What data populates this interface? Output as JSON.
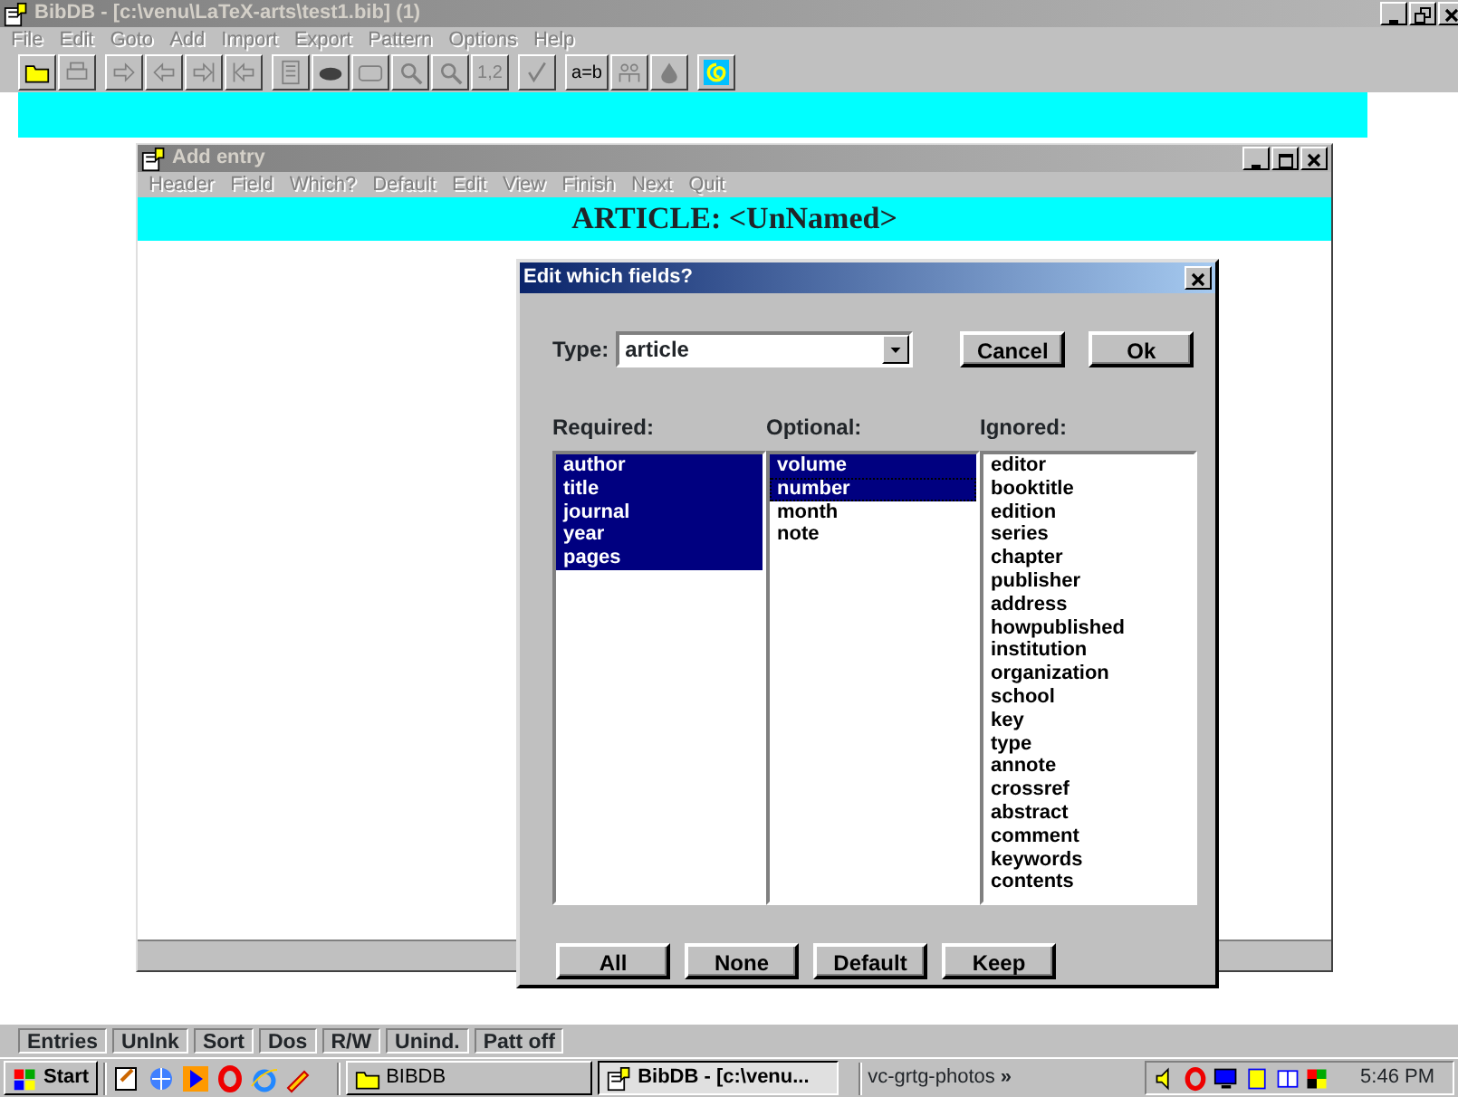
{
  "app": {
    "title": "BibDB - [c:\\venu\\LaTeX-arts\\test1.bib] (1)",
    "menu": [
      "File",
      "Edit",
      "Goto",
      "Add",
      "Import",
      "Export",
      "Pattern",
      "Options",
      "Help"
    ],
    "toolbar_labels": [
      "1,2",
      "a=b"
    ]
  },
  "child": {
    "title": "Add entry",
    "menu": [
      "Header",
      "Field",
      "Which?",
      "Default",
      "Edit",
      "View",
      "Finish",
      "Next",
      "Quit"
    ],
    "header": "ARTICLE: <UnNamed>"
  },
  "dialog": {
    "title": "Edit which fields?",
    "type_label": "Type:",
    "type_value": "article",
    "top_buttons": [
      "Cancel",
      "Ok"
    ],
    "lists": [
      {
        "heading": "Required:",
        "items": [
          {
            "text": "author",
            "selected": true,
            "focused": false
          },
          {
            "text": "title",
            "selected": true,
            "focused": false
          },
          {
            "text": "journal",
            "selected": true,
            "focused": false
          },
          {
            "text": "year",
            "selected": true,
            "focused": false
          },
          {
            "text": "pages",
            "selected": true,
            "focused": false
          }
        ]
      },
      {
        "heading": "Optional:",
        "items": [
          {
            "text": "volume",
            "selected": true,
            "focused": false
          },
          {
            "text": "number",
            "selected": true,
            "focused": true
          },
          {
            "text": "month",
            "selected": false,
            "focused": false
          },
          {
            "text": "note",
            "selected": false,
            "focused": false
          }
        ]
      },
      {
        "heading": "Ignored:",
        "items": [
          {
            "text": "editor",
            "selected": false,
            "focused": false
          },
          {
            "text": "booktitle",
            "selected": false,
            "focused": false
          },
          {
            "text": "edition",
            "selected": false,
            "focused": false
          },
          {
            "text": "series",
            "selected": false,
            "focused": false
          },
          {
            "text": "chapter",
            "selected": false,
            "focused": false
          },
          {
            "text": "publisher",
            "selected": false,
            "focused": false
          },
          {
            "text": "address",
            "selected": false,
            "focused": false
          },
          {
            "text": "howpublished",
            "selected": false,
            "focused": false
          },
          {
            "text": "institution",
            "selected": false,
            "focused": false
          },
          {
            "text": "organization",
            "selected": false,
            "focused": false
          },
          {
            "text": "school",
            "selected": false,
            "focused": false
          },
          {
            "text": "key",
            "selected": false,
            "focused": false
          },
          {
            "text": "type",
            "selected": false,
            "focused": false
          },
          {
            "text": "annote",
            "selected": false,
            "focused": false
          },
          {
            "text": "crossref",
            "selected": false,
            "focused": false
          },
          {
            "text": "abstract",
            "selected": false,
            "focused": false
          },
          {
            "text": "comment",
            "selected": false,
            "focused": false
          },
          {
            "text": "keywords",
            "selected": false,
            "focused": false
          },
          {
            "text": "contents",
            "selected": false,
            "focused": false
          }
        ]
      }
    ],
    "bottom_buttons": [
      "All",
      "None",
      "Default",
      "Keep"
    ]
  },
  "status_bar": [
    "Entries",
    "Unlnk",
    "Sort",
    "Dos",
    "R/W",
    "Unind.",
    "Patt off"
  ],
  "taskbar": {
    "start": "Start",
    "tasks": [
      {
        "label": "BIBDB",
        "selected": false
      },
      {
        "label": "BibDB - [c:\\venu...",
        "selected": true
      }
    ],
    "toolbar_name": "vc-grtg-photos",
    "chevron": "»",
    "clock": "5:46 PM"
  }
}
